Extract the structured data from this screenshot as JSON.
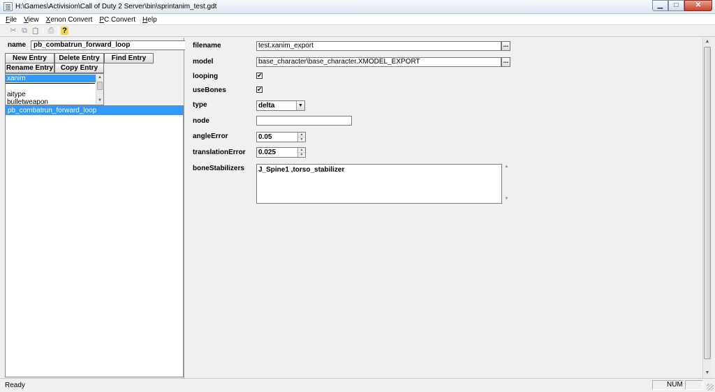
{
  "window": {
    "title": "H:\\Games\\Activision\\Call of Duty 2 Server\\bin\\sprintanim_test.gdt",
    "controls": {
      "minimize": "▁",
      "maximize": "□",
      "close": "✕"
    }
  },
  "menu": {
    "items": [
      {
        "label": "File"
      },
      {
        "label": "View"
      },
      {
        "label": "Xenon Convert"
      },
      {
        "label": "PC Convert"
      },
      {
        "label": "Help"
      }
    ]
  },
  "toolbar": {
    "buttons": [
      {
        "icon": "cut-icon",
        "glyph": "✂"
      },
      {
        "icon": "copy-icon",
        "glyph": "⧉"
      },
      {
        "icon": "paste-icon",
        "glyph": "📋"
      },
      {
        "icon": "print-icon",
        "glyph": "⎙"
      },
      {
        "icon": "help-icon",
        "glyph": "?"
      }
    ]
  },
  "left": {
    "name_label": "name",
    "name_value": "pb_combatrun_forward_loop",
    "buttons": {
      "new_entry": "New Entry",
      "delete_entry": "Delete Entry",
      "find_entry": "Find Entry",
      "rename_entry": "Rename Entry",
      "copy_entry": "Copy Entry"
    },
    "type_list": {
      "selected": "xanim",
      "items": [
        "aitype",
        "bulletweapon"
      ]
    },
    "entries": [
      "pb_combatrun_forward_loop"
    ]
  },
  "fields": {
    "filename": {
      "label": "filename",
      "value": "test.xanim_export",
      "browse": "..."
    },
    "model": {
      "label": "model",
      "value": "base_character\\base_character.XMODEL_EXPORT",
      "browse": "..."
    },
    "looping": {
      "label": "looping",
      "checked": true,
      "check_glyph": "✔"
    },
    "useBones": {
      "label": "useBones",
      "checked": true,
      "check_glyph": "✔"
    },
    "type": {
      "label": "type",
      "value": "delta"
    },
    "node": {
      "label": "node",
      "value": ""
    },
    "angleError": {
      "label": "angleError",
      "value": "0.05"
    },
    "translationError": {
      "label": "translationError",
      "value": "0.025"
    },
    "boneStabilizers": {
      "label": "boneStabilizers",
      "value": "J_Spine1 ,torso_stabilizer"
    }
  },
  "status": {
    "text": "Ready",
    "num": "NUM"
  },
  "colors": {
    "selection": "#3399ff",
    "background": "#f0f0f0"
  }
}
